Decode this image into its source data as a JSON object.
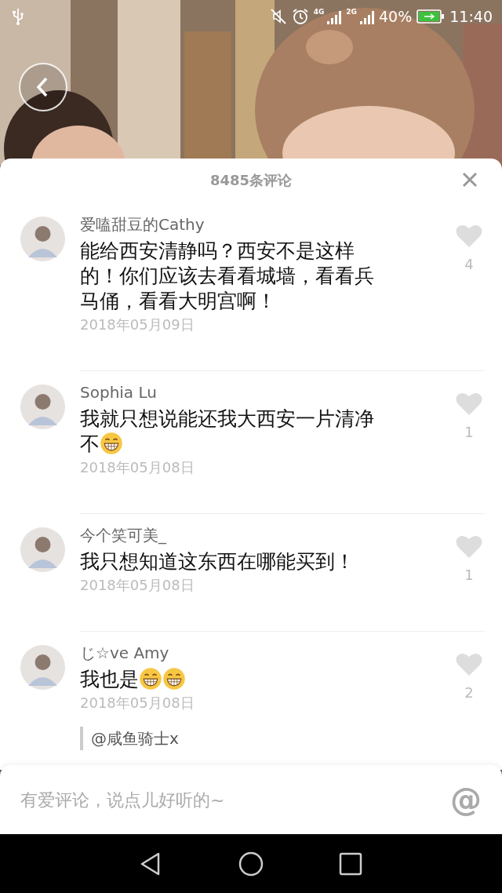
{
  "status_bar": {
    "network_1": "4G",
    "network_2": "2G",
    "battery": "40%",
    "time": "11:40"
  },
  "header": {
    "title": "8485条评论"
  },
  "comments": [
    {
      "author": "爱嗑甜豆的Cathy",
      "segments": [
        {
          "kind": "text",
          "text": "能给西安清静吗？西安不是这样的！你们应该去看看城墙，看看兵马俑，看看大明宫啊！"
        }
      ],
      "date": "2018年05月09日",
      "likes": "4",
      "liked": false
    },
    {
      "author": "Sophia Lu",
      "segments": [
        {
          "kind": "text",
          "text": "我就只想说能还我大西安一片清净不"
        },
        {
          "kind": "emoji"
        }
      ],
      "date": "2018年05月08日",
      "likes": "1",
      "liked": false
    },
    {
      "author": "今个笑可美_",
      "segments": [
        {
          "kind": "text",
          "text": "我只想知道这东西在哪能买到！"
        }
      ],
      "date": "2018年05月08日",
      "likes": "1",
      "liked": false
    },
    {
      "author": "じ☆ve Amy",
      "segments": [
        {
          "kind": "text",
          "text": "我也是"
        },
        {
          "kind": "emoji"
        },
        {
          "kind": "emoji"
        }
      ],
      "date": "2018年05月08日",
      "likes": "2",
      "liked": false,
      "reply": "@咸鱼骑士x"
    }
  ],
  "input": {
    "placeholder": "有爱评论，说点儿好听的~",
    "at_symbol": "@"
  }
}
